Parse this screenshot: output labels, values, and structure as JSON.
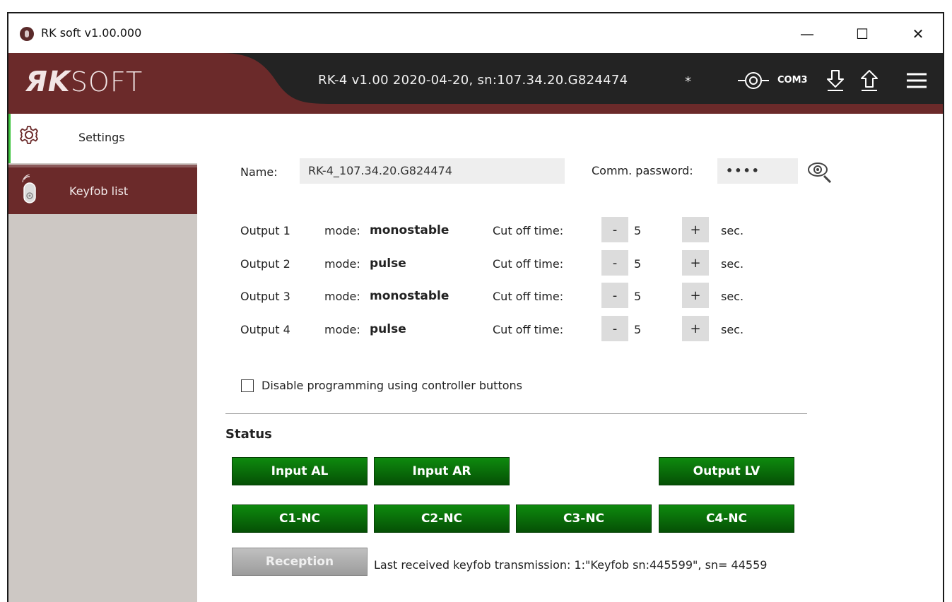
{
  "window": {
    "title": "RK soft v1.00.000",
    "controls": {
      "minimize": "—",
      "maximize": "☐",
      "close": "✕"
    }
  },
  "header": {
    "logo_r": "ЯK",
    "logo_soft": "SOFT",
    "device_info": "RK-4 v1.00 2020-04-20,  sn:107.34.20.G824474",
    "modified_marker": "*",
    "port": "COM3",
    "icons": [
      "connection-icon",
      "download-icon",
      "upload-icon",
      "menu-icon"
    ]
  },
  "sidebar": {
    "items": [
      {
        "label": "Settings",
        "icon": "gear-icon",
        "active": true
      },
      {
        "label": "Keyfob list",
        "icon": "keyfob-icon",
        "active": false
      }
    ]
  },
  "settings": {
    "name_label": "Name:",
    "name_value": "RK-4_107.34.20.G824474",
    "password_label": "Comm. password:",
    "password_value": "••••",
    "outputs": [
      {
        "label": "Output 1",
        "mode_label": "mode:",
        "mode": "monostable",
        "cutoff_label": "Cut off time:",
        "minus": "-",
        "value": "5",
        "plus": "+",
        "unit": "sec."
      },
      {
        "label": "Output 2",
        "mode_label": "mode:",
        "mode": "pulse",
        "cutoff_label": "Cut off time:",
        "minus": "-",
        "value": "5",
        "plus": "+",
        "unit": "sec."
      },
      {
        "label": "Output 3",
        "mode_label": "mode:",
        "mode": "monostable",
        "cutoff_label": "Cut off time:",
        "minus": "-",
        "value": "5",
        "plus": "+",
        "unit": "sec."
      },
      {
        "label": "Output 4",
        "mode_label": "mode:",
        "mode": "pulse",
        "cutoff_label": "Cut off time:",
        "minus": "-",
        "value": "5",
        "plus": "+",
        "unit": "sec."
      }
    ],
    "disable_programming_label": "Disable programming using controller buttons",
    "disable_programming_checked": false
  },
  "status": {
    "title": "Status",
    "row1": [
      "Input AL",
      "Input AR",
      "Output LV"
    ],
    "row2": [
      "C1-NC",
      "C2-NC",
      "C3-NC",
      "C4-NC"
    ],
    "reception_label": "Reception",
    "last_received": "Last received keyfob transmission:   1:\"Keyfob sn:445599\", sn= 44559"
  },
  "colors": {
    "header_bg": "#232323",
    "accent_maroon": "#6b2a2a",
    "active_green": "#3ec43e",
    "status_green": "#0a6e0a",
    "sidebar_bg": "#cdc8c4"
  }
}
